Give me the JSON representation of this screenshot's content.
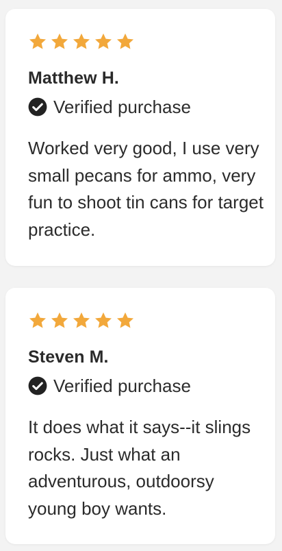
{
  "colors": {
    "page_bg": "#f3f3f3",
    "card_bg": "#ffffff",
    "star": "#f2a83b",
    "text": "#2b2b2b",
    "verified_icon": "#222222"
  },
  "reviews": [
    {
      "rating": 5,
      "star_icon": "star-icon",
      "name": "Matthew H.",
      "verified_icon": "check-circle-icon",
      "verified_label": "Verified purchase",
      "text": "Worked very good, I use very small pecans for ammo, very fun to shoot tin cans for target practice."
    },
    {
      "rating": 5,
      "star_icon": "star-icon",
      "name": "Steven M.",
      "verified_icon": "check-circle-icon",
      "verified_label": "Verified purchase",
      "text": "It does what it says--it slings rocks. Just what an adventurous, outdoorsy young boy wants."
    }
  ]
}
